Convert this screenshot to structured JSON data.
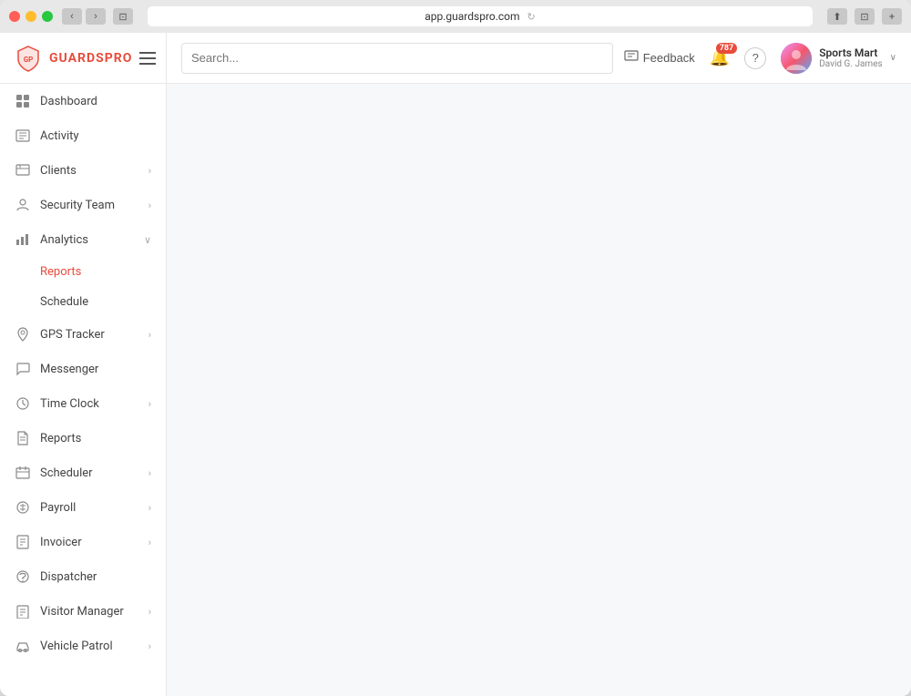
{
  "window": {
    "url": "app.guardspro.com"
  },
  "logo": {
    "text": "GUARDSPRO",
    "icon": "GP"
  },
  "header": {
    "search_placeholder": "Search...",
    "feedback_label": "Feedback",
    "notification_count": "787",
    "user_name": "Sports Mart",
    "user_sub": "David G. James",
    "help_label": "?"
  },
  "sidebar": {
    "items": [
      {
        "id": "dashboard",
        "label": "Dashboard",
        "icon": "⊞",
        "has_chevron": false,
        "active": false
      },
      {
        "id": "activity",
        "label": "Activity",
        "icon": "📋",
        "has_chevron": false,
        "active": false
      },
      {
        "id": "clients",
        "label": "Clients",
        "icon": "🖥",
        "has_chevron": true,
        "active": false
      },
      {
        "id": "security-team",
        "label": "Security Team",
        "icon": "👤",
        "has_chevron": true,
        "active": false
      },
      {
        "id": "analytics",
        "label": "Analytics",
        "icon": "📊",
        "has_chevron_down": true,
        "active": false,
        "expanded": true
      },
      {
        "id": "gps-tracker",
        "label": "GPS Tracker",
        "icon": "📍",
        "has_chevron": true,
        "active": false
      },
      {
        "id": "messenger",
        "label": "Messenger",
        "icon": "💬",
        "has_chevron": false,
        "active": false
      },
      {
        "id": "time-clock",
        "label": "Time Clock",
        "icon": "🕐",
        "has_chevron": true,
        "active": false
      },
      {
        "id": "reports",
        "label": "Reports",
        "icon": "📄",
        "has_chevron": false,
        "active": false
      },
      {
        "id": "scheduler",
        "label": "Scheduler",
        "icon": "📅",
        "has_chevron": true,
        "active": false
      },
      {
        "id": "payroll",
        "label": "Payroll",
        "icon": "💰",
        "has_chevron": true,
        "active": false
      },
      {
        "id": "invoicer",
        "label": "Invoicer",
        "icon": "🧾",
        "has_chevron": true,
        "active": false
      },
      {
        "id": "dispatcher",
        "label": "Dispatcher",
        "icon": "🔔",
        "has_chevron": false,
        "active": false
      },
      {
        "id": "visitor-manager",
        "label": "Visitor Manager",
        "icon": "🪪",
        "has_chevron": true,
        "active": false
      },
      {
        "id": "vehicle-patrol",
        "label": "Vehicle Patrol",
        "icon": "🚗",
        "has_chevron": true,
        "active": false
      }
    ],
    "analytics_sub": [
      {
        "id": "reports-sub",
        "label": "Reports",
        "active": true
      },
      {
        "id": "schedule-sub",
        "label": "Schedule",
        "active": false
      }
    ]
  }
}
